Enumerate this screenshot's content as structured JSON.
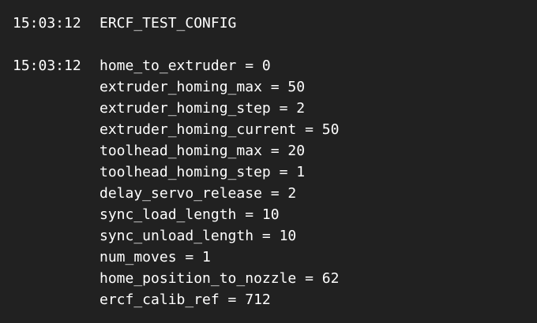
{
  "console": {
    "entries": [
      {
        "timestamp": "15:03:12",
        "lines": [
          "ERCF_TEST_CONFIG"
        ]
      },
      {
        "timestamp": "15:03:12",
        "lines": [
          "home_to_extruder = 0",
          "extruder_homing_max = 50",
          "extruder_homing_step = 2",
          "extruder_homing_current = 50",
          "toolhead_homing_max = 20",
          "toolhead_homing_step = 1",
          "delay_servo_release = 2",
          "sync_load_length = 10",
          "sync_unload_length = 10",
          "num_moves = 1",
          "home_position_to_nozzle = 62",
          "ercf_calib_ref = 712"
        ]
      }
    ]
  },
  "colors": {
    "background": "#212121",
    "text": "#ffffff"
  }
}
